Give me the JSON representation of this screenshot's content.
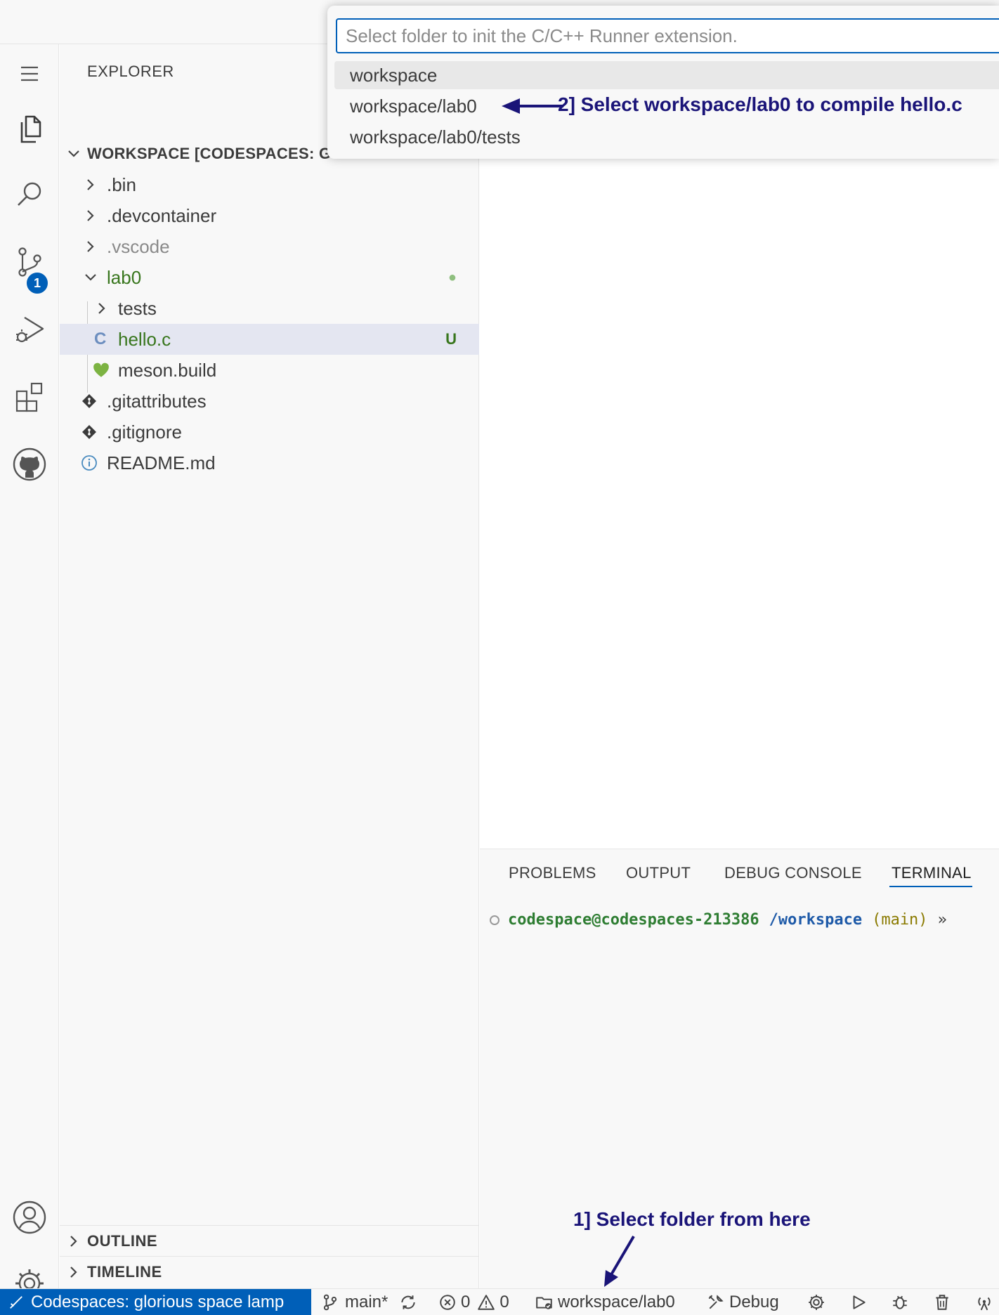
{
  "explorer": {
    "title": "EXPLORER",
    "workspace_label": "WORKSPACE [CODESPACES: G",
    "tree": [
      {
        "label": ".bin"
      },
      {
        "label": ".devcontainer"
      },
      {
        "label": ".vscode"
      },
      {
        "label": "lab0",
        "decoration": "●"
      },
      {
        "label": "tests"
      },
      {
        "label": "hello.c",
        "decoration": "U",
        "icon_glyph": "C"
      },
      {
        "label": "meson.build"
      },
      {
        "label": ".gitattributes"
      },
      {
        "label": ".gitignore"
      },
      {
        "label": "README.md"
      }
    ],
    "outline_label": "OUTLINE",
    "timeline_label": "TIMELINE"
  },
  "activity": {
    "scm_badge": "1",
    "icons": [
      "menu-icon",
      "files-icon",
      "search-icon",
      "source-control-icon",
      "run-debug-icon",
      "extensions-icon",
      "github-icon",
      "account-icon",
      "settings-gear-icon"
    ]
  },
  "quick_pick": {
    "placeholder": "Select folder to init the C/C++ Runner extension.",
    "items": [
      "workspace",
      "workspace/lab0",
      "workspace/lab0/tests"
    ]
  },
  "panel": {
    "tabs": [
      "PROBLEMS",
      "OUTPUT",
      "DEBUG CONSOLE",
      "TERMINAL"
    ],
    "active_tab": "TERMINAL",
    "terminal": {
      "user_host": "codespace@codespaces-213386",
      "path": "/workspace",
      "branch": "(main)",
      "prompt": "»"
    }
  },
  "statusbar": {
    "remote": "Codespaces: glorious space lamp",
    "branch": "main*",
    "errors": "0",
    "warnings": "0",
    "folder": "workspace/lab0",
    "debug": "Debug"
  },
  "annotations": {
    "step1": "1] Select folder from here",
    "step2": "2] Select workspace/lab0 to compile hello.c"
  },
  "colors": {
    "accent": "#005fb8",
    "git_green": "#38761d",
    "annotation": "#1a1478"
  }
}
